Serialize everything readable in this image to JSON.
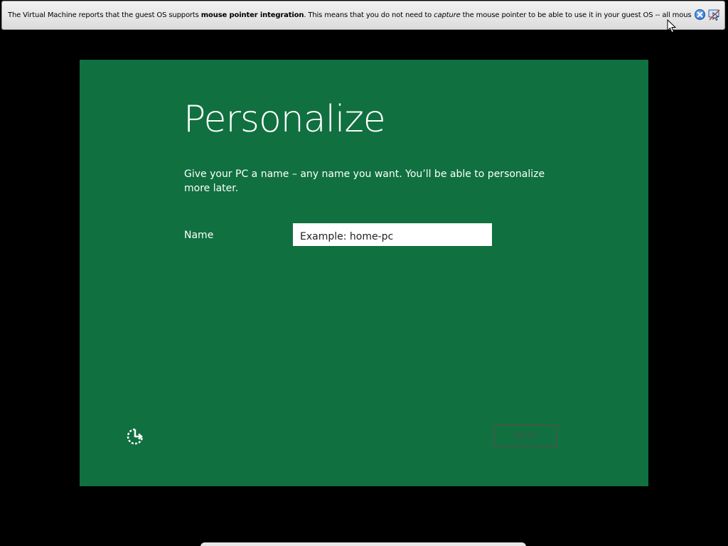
{
  "notification": {
    "text_part1": "The Virtual Machine reports that the guest OS supports ",
    "text_bold": "mouse pointer integration",
    "text_part2": ". This means that you do not need to ",
    "text_italic": "capture",
    "text_part3": " the mouse pointer to be able to use it in your guest OS -- all mouse",
    "close_icon": "close-circle-icon",
    "mouse_integration_icon": "mouse-integration-off-icon"
  },
  "setup": {
    "title": "Personalize",
    "instruction": "Give your PC a name – any name you want. You’ll be able to personalize more later.",
    "name_label": "Name",
    "name_input": {
      "value": "",
      "placeholder": "Example: home-pc"
    },
    "next_label": "Next",
    "ease_of_access_icon": "ease-of-access-icon"
  },
  "colors": {
    "panel_background": "#107040",
    "screen_background": "#000000",
    "next_disabled": "#3c5a48"
  }
}
